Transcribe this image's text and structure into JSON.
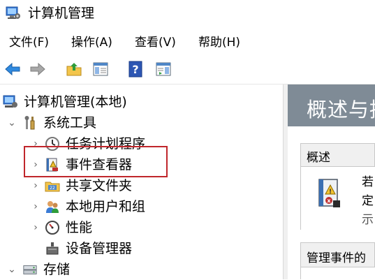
{
  "window": {
    "title": "计算机管理"
  },
  "menu": [
    {
      "label": "文件(F)"
    },
    {
      "label": "操作(A)"
    },
    {
      "label": "查看(V)"
    },
    {
      "label": "帮助(H)"
    }
  ],
  "toolbar": {
    "buttons": [
      "back-arrow-icon",
      "forward-arrow-icon",
      "up-folder-icon",
      "show-hide-tree-icon",
      "help-icon",
      "action-pane-icon"
    ]
  },
  "tree": {
    "items": [
      {
        "label": "计算机管理(本地)",
        "icon": "computer-management-icon",
        "expander": ""
      },
      {
        "label": "系统工具",
        "icon": "system-tools-icon",
        "expander": "⌄"
      },
      {
        "label": "任务计划程序",
        "icon": "task-scheduler-icon",
        "expander": "›"
      },
      {
        "label": "事件查看器",
        "icon": "event-viewer-icon",
        "expander": "›"
      },
      {
        "label": "共享文件夹",
        "icon": "shared-folders-icon",
        "expander": "›"
      },
      {
        "label": "本地用户和组",
        "icon": "local-users-groups-icon",
        "expander": "›"
      },
      {
        "label": "性能",
        "icon": "performance-icon",
        "expander": "›"
      },
      {
        "label": "设备管理器",
        "icon": "device-manager-icon",
        "expander": ""
      },
      {
        "label": "存储",
        "icon": "storage-icon",
        "expander": "⌄"
      }
    ]
  },
  "right_pane": {
    "banner_title": "概述与持",
    "overview_header": "概述",
    "overview_lines": [
      "若",
      "定",
      "示"
    ],
    "manage_header": "管理事件的"
  },
  "colors": {
    "highlight": "#c0262b",
    "banner": "#7f8b96"
  }
}
